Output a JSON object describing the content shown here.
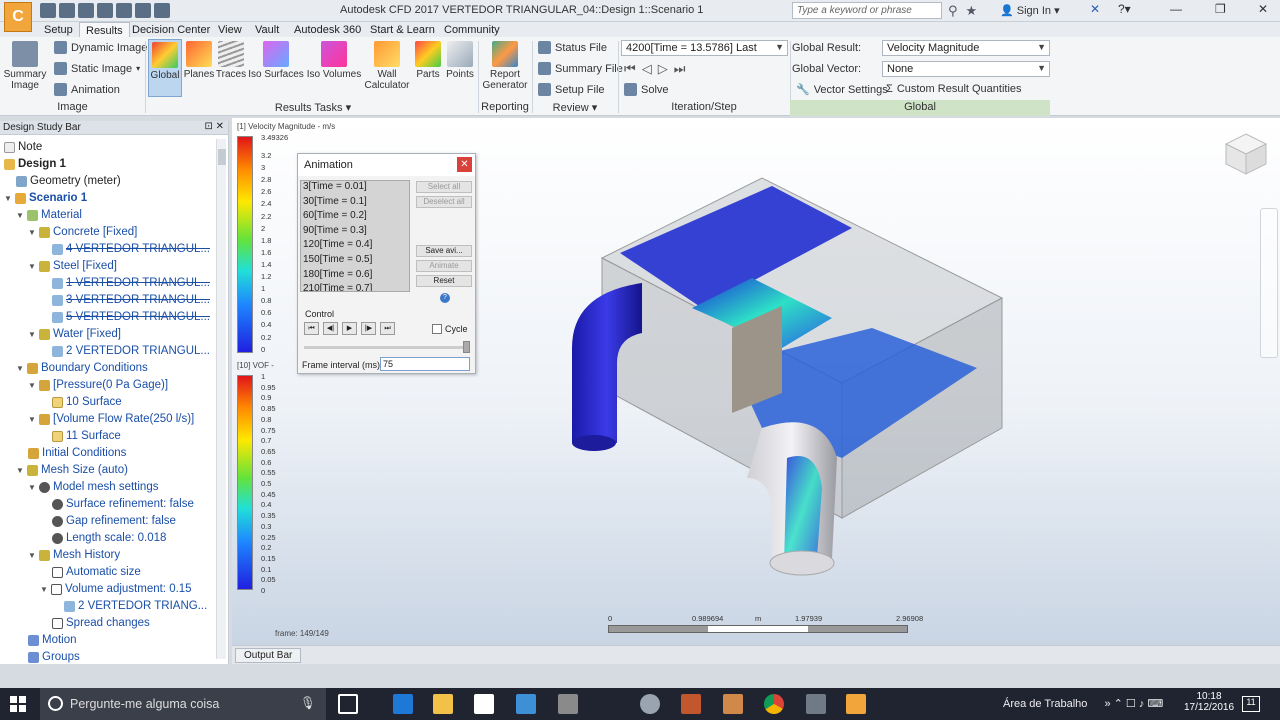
{
  "app": {
    "title": "Autodesk CFD 2017   VERTEDOR TRIANGULAR_04::Design 1::Scenario 1",
    "logo_letter": "C",
    "search_placeholder": "Type a keyword or phrase",
    "sign_in": "Sign In"
  },
  "ribbon_tabs": [
    "Setup",
    "Results",
    "Decision Center",
    "View",
    "Vault",
    "Autodesk 360",
    "Start & Learn",
    "Community"
  ],
  "active_tab": "Results",
  "ribbon": {
    "image": {
      "summary_image": "Summary Image",
      "dynamic_image": "Dynamic Image",
      "static_image": "Static Image",
      "animation": "Animation",
      "label": "Image"
    },
    "results_tasks": {
      "global": "Global",
      "planes": "Planes",
      "traces": "Traces",
      "iso_surfaces": "Iso Surfaces",
      "iso_volumes": "Iso Volumes",
      "wall_calculator": "Wall Calculator",
      "parts": "Parts",
      "points": "Points",
      "label": "Results Tasks"
    },
    "reporting": {
      "report_generator": "Report Generator",
      "label": "Reporting"
    },
    "review": {
      "status_file": "Status File",
      "summary_file": "Summary File",
      "setup_file": "Setup File",
      "label": "Review"
    },
    "iteration": {
      "selected": "4200[Time = 13.5786] Last",
      "solve": "Solve",
      "label": "Iteration/Step"
    },
    "global": {
      "global_result_label": "Global Result:",
      "global_result_value": "Velocity Magnitude",
      "global_vector_label": "Global Vector:",
      "global_vector_value": "None",
      "vector_settings": "Vector Settings",
      "custom_result_quantities": "Custom Result Quantities",
      "label": "Global"
    }
  },
  "design_study_bar": {
    "title": "Design Study Bar",
    "items": [
      {
        "text": "Note"
      },
      {
        "text": "Design 1"
      },
      {
        "text": "Geometry (meter)"
      },
      {
        "text": "Scenario 1"
      },
      {
        "text": "Material"
      },
      {
        "text": "Concrete [Fixed]"
      },
      {
        "text": "4 VERTEDOR TRIANGUL..."
      },
      {
        "text": "Steel [Fixed]"
      },
      {
        "text": "1 VERTEDOR TRIANGUL..."
      },
      {
        "text": "3 VERTEDOR TRIANGUL..."
      },
      {
        "text": "5 VERTEDOR TRIANGUL..."
      },
      {
        "text": "Water [Fixed]"
      },
      {
        "text": "2 VERTEDOR TRIANGUL..."
      },
      {
        "text": "Boundary Conditions"
      },
      {
        "text": "[Pressure(0 Pa Gage)]"
      },
      {
        "text": "10 Surface"
      },
      {
        "text": "[Volume Flow Rate(250 l/s)]"
      },
      {
        "text": "11 Surface"
      },
      {
        "text": "Initial Conditions"
      },
      {
        "text": "Mesh Size (auto)"
      },
      {
        "text": "Model mesh settings"
      },
      {
        "text": "Surface refinement: false"
      },
      {
        "text": "Gap refinement: false"
      },
      {
        "text": "Length scale: 0.018"
      },
      {
        "text": "Mesh History"
      },
      {
        "text": "Automatic size"
      },
      {
        "text": "Volume adjustment: 0.15"
      },
      {
        "text": "2 VERTEDOR TRIANG..."
      },
      {
        "text": "Spread changes"
      },
      {
        "text": "Motion"
      },
      {
        "text": "Groups"
      }
    ]
  },
  "legend_velocity": {
    "title": "[1] Velocity Magnitude - m/s",
    "max": "3.49326",
    "ticks": [
      "3.2",
      "3",
      "2.8",
      "2.6",
      "2.4",
      "2.2",
      "2",
      "1.8",
      "1.6",
      "1.4",
      "1.2",
      "1",
      "0.8",
      "0.6",
      "0.4",
      "0.2",
      "0"
    ]
  },
  "legend_vof": {
    "title": "[10] VOF -",
    "ticks": [
      "1",
      "0.95",
      "0.9",
      "0.85",
      "0.8",
      "0.75",
      "0.7",
      "0.65",
      "0.6",
      "0.55",
      "0.5",
      "0.45",
      "0.4",
      "0.35",
      "0.3",
      "0.25",
      "0.2",
      "0.15",
      "0.1",
      "0.05",
      "0"
    ]
  },
  "animation_dialog": {
    "title": "Animation",
    "list": [
      "3[Time = 0.01]",
      "30[Time = 0.1]",
      "60[Time = 0.2]",
      "90[Time = 0.3]",
      "120[Time = 0.4]",
      "150[Time = 0.5]",
      "180[Time = 0.6]",
      "210[Time = 0.7]"
    ],
    "select_all": "Select all",
    "deselect_all": "Deselect all",
    "save_avi": "Save avi...",
    "animate": "Animate",
    "reset": "Reset",
    "control_label": "Control",
    "cycle_label": "Cycle",
    "frame_interval_label": "Frame interval (ms)",
    "frame_interval_value": "75",
    "transport": [
      "⏮",
      "◀|",
      "▶",
      "|▶",
      "⏭"
    ]
  },
  "viewport": {
    "frame": "frame: 149/149",
    "scale_ticks": [
      "0",
      "0.989694",
      "m",
      "1.97939",
      "2.96908"
    ]
  },
  "output_bar": "Output Bar",
  "taskbar": {
    "search_placeholder": "Pergunte-me alguma coisa",
    "tray_label": "Área de Trabalho",
    "time": "10:18",
    "date": "17/12/2016"
  }
}
